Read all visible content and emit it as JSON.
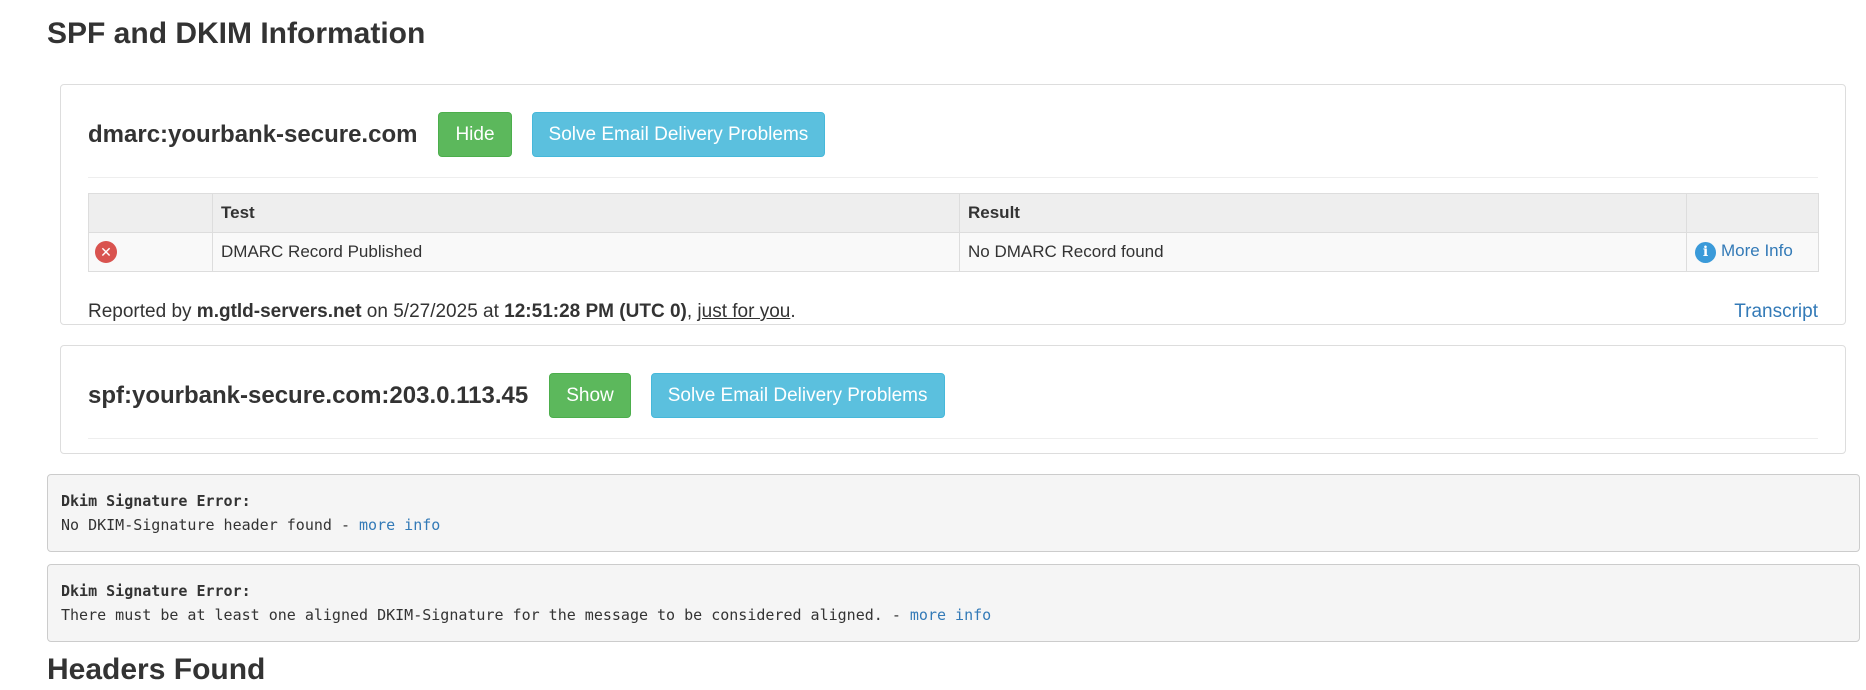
{
  "page": {
    "title": "SPF and DKIM Information",
    "next_section_title": "Headers Found"
  },
  "dmarc_panel": {
    "heading": "dmarc:yourbank-secure.com",
    "toggle_label": "Hide",
    "solve_label": "Solve Email Delivery Problems",
    "table": {
      "columns": [
        "",
        "Test",
        "Result",
        ""
      ],
      "rows": [
        {
          "status_icon": "error-circle-icon",
          "test": "DMARC Record Published",
          "result": "No DMARC Record found",
          "more_info": "More Info"
        }
      ]
    },
    "report": {
      "prefix": "Reported by ",
      "server": "m.gtld-servers.net",
      "on": " on ",
      "date": "5/27/2025",
      "at": " at ",
      "time": "12:51:28 PM (UTC 0)",
      "comma": ", ",
      "just_for_you": "just for you",
      "period": "."
    },
    "transcript_label": "Transcript"
  },
  "spf_panel": {
    "heading": "spf:yourbank-secure.com:203.0.113.45",
    "toggle_label": "Show",
    "solve_label": "Solve Email Delivery Problems"
  },
  "dkim_errors": [
    {
      "title": "Dkim Signature Error:",
      "message": "No DKIM-Signature header found - ",
      "link": "more info"
    },
    {
      "title": "Dkim Signature Error:",
      "message": "There must be at least one aligned DKIM-Signature for the message to be considered aligned. - ",
      "link": "more info"
    }
  ],
  "colors": {
    "green_button": "#5cb85c",
    "blue_button": "#5bc0de",
    "error_red": "#d9534f",
    "link_blue": "#337ab7"
  }
}
